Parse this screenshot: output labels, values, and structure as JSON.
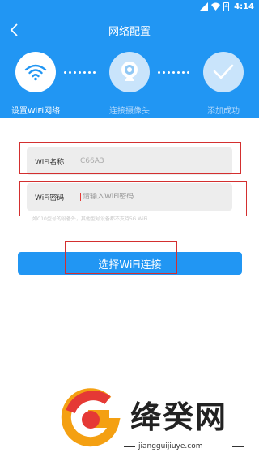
{
  "status_bar": {
    "time": "4:14",
    "battery_level": "4"
  },
  "header": {
    "title": "网络配置",
    "steps": [
      {
        "label": "设置WiFi网络",
        "icon": "wifi-icon",
        "state": "active"
      },
      {
        "label": "连接摄像头",
        "icon": "camera-icon",
        "state": "inactive"
      },
      {
        "label": "添加成功",
        "icon": "checkmark-icon",
        "state": "inactive"
      }
    ]
  },
  "form": {
    "wifi_name_label": "WiFi名称",
    "wifi_name_value": "C66A3",
    "wifi_password_label": "WiFi密码",
    "wifi_password_placeholder": "请输入WiFi密码",
    "hint": "如C10型号的设备外，其他型号设备都不支持5G WiFi",
    "connect_button": "选择WiFi连接"
  },
  "watermark": {
    "text": "绛癸网",
    "url": "jiangguijiuye.com"
  },
  "colors": {
    "primary": "#2196f3",
    "highlight_box": "#d32f2f",
    "field_bg": "#ededed"
  }
}
